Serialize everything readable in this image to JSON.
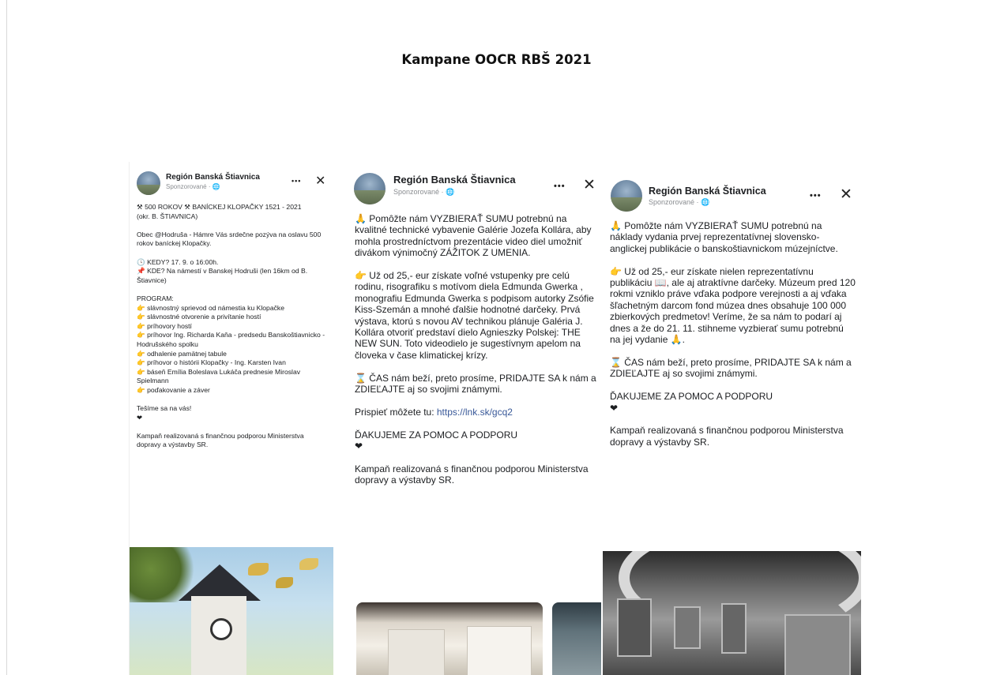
{
  "document": {
    "title": "Kampane OOCR RBŠ 2021"
  },
  "posts": [
    {
      "page_name": "Región Banská Štiavnica",
      "sponsored": "Sponzorované · 🌐",
      "more": "•••",
      "close": "✕",
      "text": "⚒ 500 ROKOV ⚒ BANÍCKEJ KLOPAČKY 1521 - 2021\n(okr. B. ŠTIAVNICA)\n\nObec @Hodruša - Hámre Vás srdečne pozýva na oslavu 500 rokov baníckej Klopačky.\n\n🕓 KEDY? 17. 9. o 16:00h.\n📌 KDE? Na námestí v Banskej Hodruši (len 16km od B. Štiavnice)\n\nPROGRAM:\n👉 slávnostný sprievod od námestia ku Klopačke\n👉 slávnostné otvorenie a privítanie hostí\n👉 príhovory hostí\n👉 príhovor Ing. Richarda Kaňa - predsedu Banskoštiavnicko - Hodrušského spolku\n👉 odhalenie pamätnej tabule\n👉 príhovor o histórii Klopačky - Ing. Karsten Ivan\n👉 báseň Emília Boleslava Lukáča prednesie Miroslav Spielmann\n👉 poďakovanie a záver\n\nTešíme sa na vás!\n❤\n\nKampaň realizovaná s finančnou podporou Ministerstva dopravy a výstavby SR."
    },
    {
      "page_name": "Región Banská Štiavnica",
      "sponsored": "Sponzorované · 🌐",
      "more": "•••",
      "close": "✕",
      "text_a": "🙏 Pomôžte nám VYZBIERAŤ SUMU potrebnú na kvalitné technické vybavenie Galérie Jozefa Kollára, aby mohla prostredníctvom prezentácie video diel umožniť divákom výnimočný ZÁŽITOK Z UMENIA.\n\n👉 Už od 25,- eur získate voľné vstupenky pre celú rodinu, risografiku s motívom diela Edmunda Gwerka , monografiu Edmunda Gwerka s podpisom autorky Zsófie Kiss-Szemán a mnohé ďalšie hodnotné darčeky. Prvá výstava, ktorú s novou AV technikou plánuje Galéria J. Kollára otvoriť predstaví dielo Agnieszky Polskej: THE NEW SUN. Toto videodielo je sugestívnym apelom na človeka v čase klimatickej krízy.\n\n⌛ ČAS nám beží, preto prosíme, PRIDAJTE SA k nám a ZDIEĽAJTE aj so svojimi známymi.\n\nPrispieť môžete tu: ",
      "link": "https://lnk.sk/gcq2",
      "text_b": "\n\nĎAKUJEME ZA POMOC A PODPORU\n❤\n\nKampaň realizovaná s finančnou podporou Ministerstva dopravy a výstavby SR."
    },
    {
      "page_name": "Región Banská Štiavnica",
      "sponsored": "Sponzorované · 🌐",
      "more": "•••",
      "close": "✕",
      "text": "🙏 Pomôžte nám VYZBIERAŤ SUMU potrebnú na náklady vydania prvej reprezentatívnej slovensko-anglickej publikácie o banskoštiavnickom múzejníctve.\n\n👉 Už od 25,- eur získate nielen reprezentatívnu publikáciu 📖, ale aj atraktívne darčeky. Múzeum pred 120 rokmi vzniklo práve vďaka podpore verejnosti a aj vďaka šľachetným darcom fond múzea dnes obsahuje 100 000 zbierkových predmetov! Veríme, že sa nám to podarí aj dnes a že do 21. 11. stihneme vyzbierať sumu potrebnú na jej vydanie 🙏.\n\n⌛ ČAS nám beží, preto prosíme, PRIDAJTE SA k nám a ZDIEĽAJTE aj so svojimi známymi.\n\nĎAKUJEME ZA POMOC A PODPORU\n❤\n\nKampaň realizovaná s finančnou podporou Ministerstva dopravy a výstavby SR."
    }
  ]
}
